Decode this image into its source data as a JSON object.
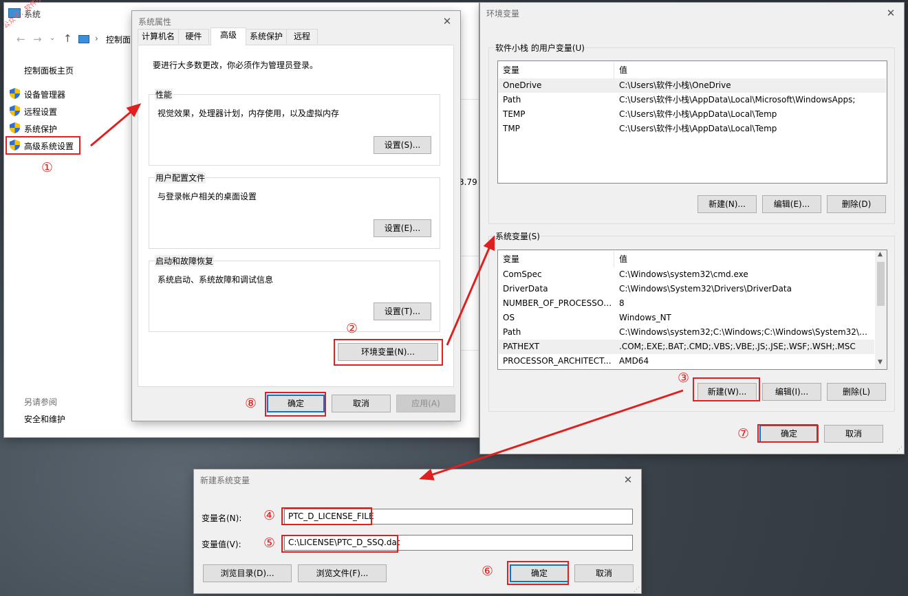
{
  "watermark": "公众号：软件小栈",
  "system_window": {
    "title": "系统",
    "breadcrumb": "控制面",
    "sidebar_home": "控制面板主页",
    "items": [
      "设备管理器",
      "远程设置",
      "系统保护",
      "高级系统设置"
    ],
    "see_also": "另请参阅",
    "security": "安全和维护",
    "partial_value": "3.79"
  },
  "sysprops": {
    "title": "系统属性",
    "tabs": [
      "计算机名",
      "硬件",
      "高级",
      "系统保护",
      "远程"
    ],
    "admin_note": "要进行大多数更改，你必须作为管理员登录。",
    "perf_label": "性能",
    "perf_desc": "视觉效果，处理器计划，内存使用，以及虚拟内存",
    "perf_btn": "设置(S)...",
    "profile_label": "用户配置文件",
    "profile_desc": "与登录帐户相关的桌面设置",
    "profile_btn": "设置(E)...",
    "startup_label": "启动和故障恢复",
    "startup_desc": "系统启动、系统故障和调试信息",
    "startup_btn": "设置(T)...",
    "env_btn": "环境变量(N)...",
    "ok": "确定",
    "cancel": "取消",
    "apply": "应用(A)"
  },
  "envvars": {
    "title": "环境变量",
    "user_group": "软件小栈 的用户变量(U)",
    "col_var": "变量",
    "col_val": "值",
    "user_vars": [
      {
        "name": "OneDrive",
        "value": "C:\\Users\\软件小栈\\OneDrive"
      },
      {
        "name": "Path",
        "value": "C:\\Users\\软件小栈\\AppData\\Local\\Microsoft\\WindowsApps;"
      },
      {
        "name": "TEMP",
        "value": "C:\\Users\\软件小栈\\AppData\\Local\\Temp"
      },
      {
        "name": "TMP",
        "value": "C:\\Users\\软件小栈\\AppData\\Local\\Temp"
      }
    ],
    "user_new": "新建(N)...",
    "user_edit": "编辑(E)...",
    "user_delete": "删除(D)",
    "sys_group": "系统变量(S)",
    "sys_vars": [
      {
        "name": "ComSpec",
        "value": "C:\\Windows\\system32\\cmd.exe"
      },
      {
        "name": "DriverData",
        "value": "C:\\Windows\\System32\\Drivers\\DriverData"
      },
      {
        "name": "NUMBER_OF_PROCESSORS",
        "value": "8"
      },
      {
        "name": "OS",
        "value": "Windows_NT"
      },
      {
        "name": "Path",
        "value": "C:\\Windows\\system32;C:\\Windows;C:\\Windows\\System32\\Wb..."
      },
      {
        "name": "PATHEXT",
        "value": ".COM;.EXE;.BAT;.CMD;.VBS;.VBE;.JS;.JSE;.WSF;.WSH;.MSC"
      },
      {
        "name": "PROCESSOR_ARCHITECT...",
        "value": "AMD64"
      }
    ],
    "sys_new": "新建(W)...",
    "sys_edit": "编辑(I)...",
    "sys_delete": "删除(L)",
    "ok": "确定",
    "cancel": "取消"
  },
  "newvar": {
    "title": "新建系统变量",
    "name_label": "变量名(N):",
    "name_value": "PTC_D_LICENSE_FILE",
    "value_label": "变量值(V):",
    "value_value": "C:\\LICENSE\\PTC_D_SSQ.dat",
    "browse_dir": "浏览目录(D)...",
    "browse_file": "浏览文件(F)...",
    "ok": "确定",
    "cancel": "取消"
  },
  "steps": [
    "①",
    "②",
    "③",
    "④",
    "⑤",
    "⑥",
    "⑦",
    "⑧"
  ],
  "colors": {
    "annotation": "#e02020",
    "accent": "#0078d7"
  }
}
